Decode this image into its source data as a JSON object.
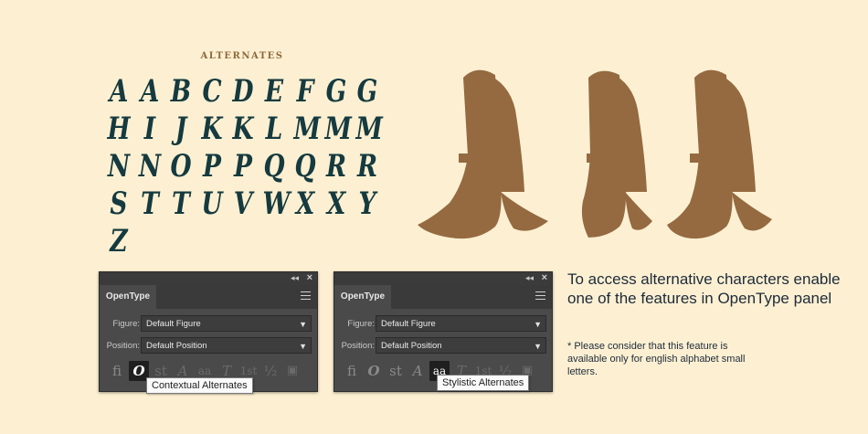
{
  "specimen": {
    "heading": "ALTERNATES",
    "glyphs": [
      "A",
      "A",
      "B",
      "C",
      "D",
      "E",
      "F",
      "G",
      "G",
      "H",
      "I",
      "J",
      "K",
      "K",
      "L",
      "M",
      "M",
      "M",
      "N",
      "N",
      "O",
      "P",
      "P",
      "Q",
      "Q",
      "R",
      "R",
      "S",
      "T",
      "T",
      "U",
      "V",
      "W",
      "X",
      "X",
      "Y",
      "Z"
    ],
    "big_letters": [
      "A",
      "A",
      "A"
    ],
    "colors": {
      "glyph": "#153a3f",
      "big": "#956a41",
      "background": "#fdf0d2"
    }
  },
  "panels": [
    {
      "tab": "OpenType",
      "figure_label": "Figure:",
      "figure_value": "Default Figure",
      "position_label": "Position:",
      "position_value": "Default Position",
      "tooltip": "Contextual Alternates",
      "active_feature": "contextual-alternates"
    },
    {
      "tab": "OpenType",
      "figure_label": "Figure:",
      "figure_value": "Default Figure",
      "position_label": "Position:",
      "position_value": "Default Position",
      "tooltip": "Stylistic Alternates",
      "active_feature": "stylistic-alternates"
    }
  ],
  "feature_icons": [
    {
      "name": "standard-ligatures-icon",
      "glyph": "fi"
    },
    {
      "name": "contextual-alternates-icon",
      "glyph": "O"
    },
    {
      "name": "discretionary-ligatures-icon",
      "glyph": "st"
    },
    {
      "name": "swash-icon",
      "glyph": "A"
    },
    {
      "name": "stylistic-alternates-icon",
      "glyph": "aa"
    },
    {
      "name": "titling-alternates-icon",
      "glyph": "T"
    },
    {
      "name": "ordinals-icon",
      "glyph": "1st"
    },
    {
      "name": "fractions-icon",
      "glyph": "½"
    },
    {
      "name": "stylistic-sets-icon",
      "glyph": "▣"
    }
  ],
  "info": {
    "main": "To access alternative characters enable one of the features in OpenType panel",
    "note": "* Please  consider that this feature is available only for english alphabet small letters."
  }
}
